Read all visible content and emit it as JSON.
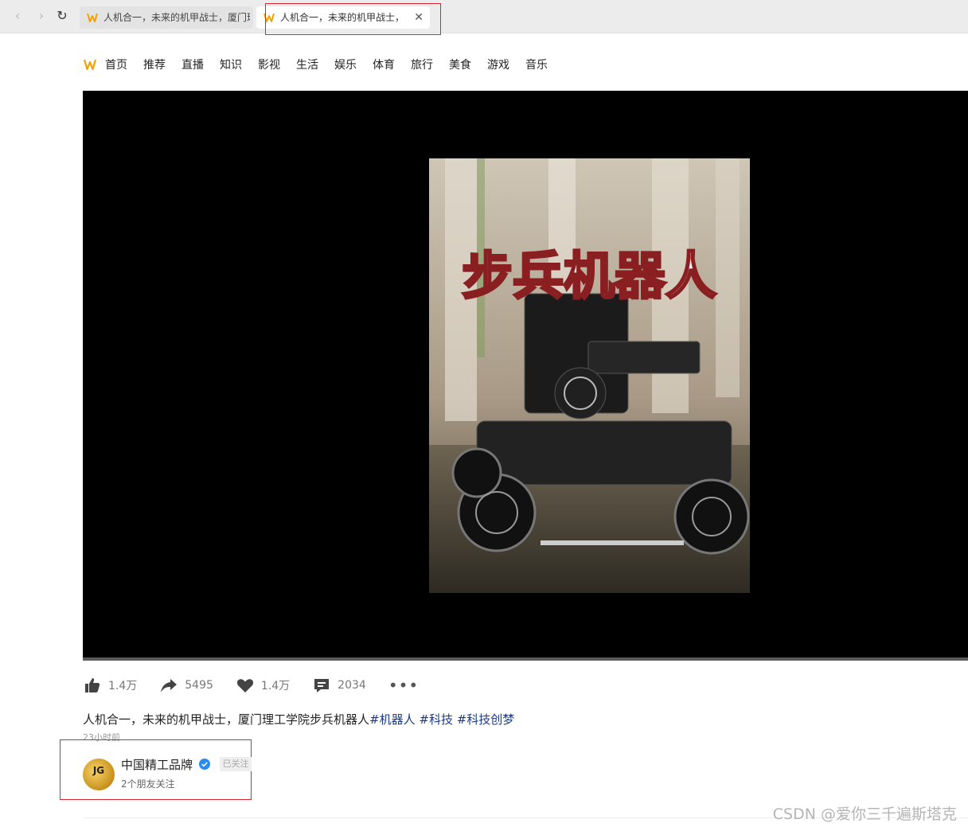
{
  "browser": {
    "tabs": [
      {
        "title": "人机合一，未来的机甲战士，厦门理",
        "active": false
      },
      {
        "title": "人机合一，未来的机甲战士，",
        "active": true,
        "close": "✕"
      }
    ],
    "back": "‹",
    "forward": "›",
    "reload": "↻"
  },
  "site_nav": {
    "items": [
      "首页",
      "推荐",
      "直播",
      "知识",
      "影视",
      "生活",
      "娱乐",
      "体育",
      "旅行",
      "美食",
      "游戏",
      "音乐"
    ]
  },
  "video": {
    "poster_title": "步兵机器人",
    "colors": {
      "background": "#000000",
      "accent": "#d6262f"
    }
  },
  "actions": {
    "like_count": "1.4万",
    "share_count": "5495",
    "favorite_count": "1.4万",
    "comment_count": "2034",
    "more": "•••"
  },
  "post": {
    "description": "人机合一，未来的机甲战士，厦门理工学院步兵机器人",
    "tags": [
      "#机器人",
      "#科技",
      "#科技创梦"
    ],
    "time": "23小时前"
  },
  "author": {
    "avatar_text": "JG",
    "name": "中国精工品牌",
    "follow_label": "已关注",
    "friends": "2个朋友关注"
  },
  "watermark": "CSDN @爱你三千遍斯塔克"
}
